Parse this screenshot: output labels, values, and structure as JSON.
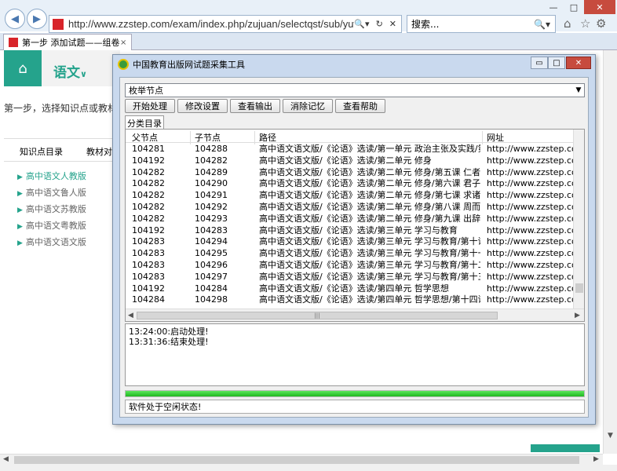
{
  "browser": {
    "url": "http://www.zzstep.com/exam/index.php/zujuan/selectqst/sub/yuwenzj_gz.html",
    "search_placeholder": "搜索...",
    "tab_title": "第一步 添加试题——组卷",
    "tab_close": "×"
  },
  "page": {
    "subject": "语文",
    "step_text": "第一步，选择知识点或教材",
    "tabs": [
      "知识点目录",
      "教材对"
    ],
    "tree": [
      "高中语文人教版",
      "高中语文鲁人版",
      "高中语文苏教版",
      "高中语文粤教版",
      "高中语文语文版"
    ]
  },
  "dialog": {
    "title": "中国教育出版网试题采集工具",
    "combo_value": "枚举节点",
    "buttons": [
      "开始处理",
      "修改设置",
      "查看输出",
      "消除记忆",
      "查看帮助"
    ],
    "tab_label": "分类目录",
    "columns": [
      "父节点",
      "子节点",
      "路径",
      "网址"
    ],
    "rows": [
      [
        "104281",
        "104288",
        "高中语文语文版/《论语》选读/第一单元 政治主张及实践/第...",
        "http://www.zzstep.com"
      ],
      [
        "104192",
        "104282",
        "高中语文语文版/《论语》选读/第二单元 修身",
        "http://www.zzstep.com"
      ],
      [
        "104282",
        "104289",
        "高中语文语文版/《论语》选读/第二单元 修身/第五课 仁者爱人",
        "http://www.zzstep.com"
      ],
      [
        "104282",
        "104290",
        "高中语文语文版/《论语》选读/第二单元 修身/第六课 君子之风",
        "http://www.zzstep.com"
      ],
      [
        "104282",
        "104291",
        "高中语文语文版/《论语》选读/第二单元 修身/第七课 求诸己",
        "http://www.zzstep.com"
      ],
      [
        "104282",
        "104292",
        "高中语文语文版/《论语》选读/第二单元 修身/第八课 周而不比",
        "http://www.zzstep.com"
      ],
      [
        "104282",
        "104293",
        "高中语文语文版/《论语》选读/第二单元 修身/第九课 出辞气...",
        "http://www.zzstep.com"
      ],
      [
        "104192",
        "104283",
        "高中语文语文版/《论语》选读/第三单元 学习与教育",
        "http://www.zzstep.com"
      ],
      [
        "104283",
        "104294",
        "高中语文语文版/《论语》选读/第三单元 学习与教育/第十课 ...",
        "http://www.zzstep.com"
      ],
      [
        "104283",
        "104295",
        "高中语文语文版/《论语》选读/第三单元 学习与教育/第十一...",
        "http://www.zzstep.com"
      ],
      [
        "104283",
        "104296",
        "高中语文语文版/《论语》选读/第三单元 学习与教育/第十二...",
        "http://www.zzstep.com"
      ],
      [
        "104283",
        "104297",
        "高中语文语文版/《论语》选读/第三单元 学习与教育/第十三...",
        "http://www.zzstep.com"
      ],
      [
        "104192",
        "104284",
        "高中语文语文版/《论语》选读/第四单元 哲学思想",
        "http://www.zzstep.com"
      ],
      [
        "104284",
        "104298",
        "高中语文语文版/《论语》选读/第四单元 哲学思想/第十四课 ...",
        "http://www.zzstep.com"
      ]
    ],
    "log": [
      "13:24:00:启动处理!",
      "13:31:36:结束处理!"
    ],
    "progress": 1.0,
    "status": "软件处于空闲状态!"
  }
}
